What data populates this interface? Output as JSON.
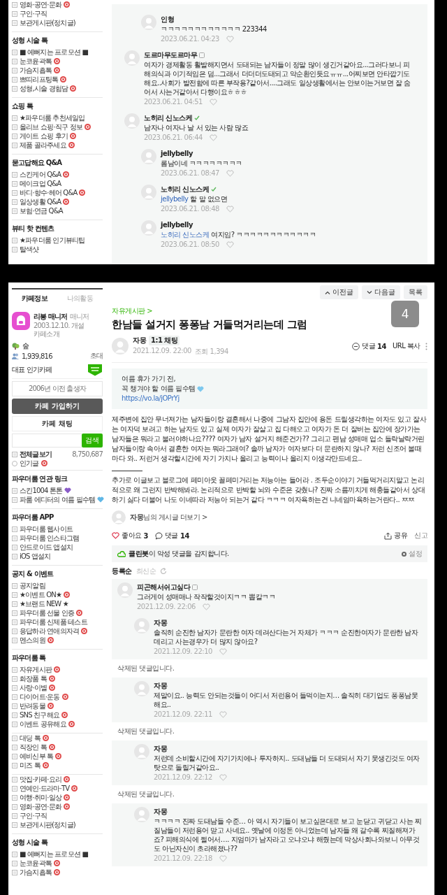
{
  "top_panel": {
    "sidebar": {
      "sections": [
        {
          "items": [
            {
              "label": "영화·공연·문화",
              "new": true
            },
            {
              "label": "구인·구직",
              "new": false
            },
            {
              "label": "보관게시판(정치글)",
              "new": false
            }
          ]
        },
        {
          "title": "성형 시술 톡",
          "items": [
            {
              "label": "■ 예뻐지는 프로모션 ■",
              "new": false
            },
            {
              "label": "눈코윤곽톡",
              "new": true
            },
            {
              "label": "가슴지흡톡",
              "new": true
            },
            {
              "label": "쁘띠리프팅톡",
              "new": true
            },
            {
              "label": "성형,시술 경험담",
              "new": true
            }
          ]
        },
        {
          "title": "쇼핑 톡",
          "items": [
            {
              "label": "★파우더룸 추천세일입",
              "new": false
            },
            {
              "label": "올리브 쇼핑·직구 정보",
              "new": true
            },
            {
              "label": "게이트 쇼핑 후기",
              "new": true
            },
            {
              "label": "제품 골라주세요",
              "new": true
            }
          ]
        },
        {
          "title": "묻고답해요 Q&A",
          "items": [
            {
              "label": "스킨케어 Q&A",
              "new": true
            },
            {
              "label": "메이크업 Q&A",
              "new": false
            },
            {
              "label": "바디·향수·헤어 Q&A",
              "new": true
            },
            {
              "label": "일상생활 Q&A",
              "new": true
            },
            {
              "label": "보험·연금 Q&A",
              "new": false
            }
          ]
        },
        {
          "title": "뷰티 핫 컨텐츠",
          "items": [
            {
              "label": "★파우더룸 인기뷰티팁",
              "new": false
            },
            {
              "label": "탈색샷",
              "new": false
            }
          ]
        }
      ]
    },
    "comments": [
      {
        "kind": "comment",
        "reply": true,
        "author": "인형",
        "text": "ㅋㅋㅋㅋㅋㅋㅋㅋㅋㅋㅋㅋ 223344",
        "date": "2023.06.21. 04:23"
      },
      {
        "kind": "comment",
        "reply": false,
        "author": "도르마무도르마무",
        "grade_icon": true,
        "text": "여자가 경제활동 활발해지면서 도태되는 남자들이 정말 많이 생긴거같아요...그러다보니 피해의식과 이기적임은 덤...그래서 더더더도태되고 악순환인듯요ㅠㅠ...어찌보면 안타깝기도해요..사회가 발전함에 따른 부작용?같아서....그래도 일상생활에서는 안보이는거보면 잘 숨어서 사는거같아서 다행이요ㅎㅎㅎ",
        "date": "2023.06.21. 04:51"
      },
      {
        "kind": "comment",
        "reply": false,
        "author": "노히리 신노스케",
        "verified": true,
        "text": "남자나 여자나 날 서 있는 사람 많죠",
        "date": "2023.06.21. 06:44"
      },
      {
        "kind": "comment",
        "reply": true,
        "author": "jellybelly",
        "text": "롬남이네 ㅋㅋㅋㅋㅋㅋㅋㅋ",
        "date": "2023.06.21. 08:47"
      },
      {
        "kind": "comment",
        "reply": true,
        "author": "노히리 신노스케",
        "verified": true,
        "mention": "jellybelly",
        "text": "할 말 없으면",
        "date": "2023.06.21. 08:48"
      },
      {
        "kind": "comment",
        "reply": true,
        "author": "jellybelly",
        "mention": "노히리 신노스케",
        "text": "여지임? ㅋㅋㅋㅋㅋㅋㅋㅋㅋㅋㅋㅋ",
        "date": "2023.06.21. 08:50"
      }
    ]
  },
  "bottom_panel": {
    "sidebar": {
      "tabs": [
        {
          "label": "카페정보",
          "selected": true
        },
        {
          "label": "나의활동",
          "selected": false
        }
      ],
      "cafe": {
        "manager": "리봉 매니저",
        "role": "매니저",
        "founded": "2003.12.10. 개설",
        "intro_link": "카페소개",
        "grade": "숲",
        "members": "1,939,816",
        "invite": "초대",
        "popular_label": "대표 인기카페",
        "restriction": "2006년 이전 출생자",
        "join_button": "카페 가입하기",
        "chat_button": "카페 채팅",
        "search_button": "검색",
        "all_posts": "전체글보기",
        "all_posts_count": "8,750,687",
        "popular_posts": "인기글",
        "popular_posts_new": true
      },
      "sections": [
        {
          "title": "파우더룸 연관 링크",
          "items": [
            {
              "label": "스킨1004 톤톤",
              "new": false,
              "color": "#8a5cc8"
            },
            {
              "label": "파룸 에디터의 여름 필수템",
              "new": false,
              "color": "#5fb7e6"
            }
          ]
        },
        {
          "title": "파우더룸 APP",
          "items": [
            {
              "label": "파우더룸 웹사이트",
              "new": false
            },
            {
              "label": "파우더룸 인스타그램",
              "new": false
            },
            {
              "label": "안드로이드 앱설치",
              "new": false
            },
            {
              "label": "iOS 앱설치",
              "new": false
            }
          ]
        },
        {
          "title": "공지 & 이벤트",
          "items": [
            {
              "label": "공지알림",
              "new": false
            },
            {
              "label": "★이벤트 ON★",
              "new": true
            },
            {
              "label": "★브랜드 NEW ★",
              "new": false
            },
            {
              "label": "파우더룸 선물 인증",
              "new": true
            },
            {
              "label": "파우더룸 신제품 테스트",
              "new": false
            },
            {
              "label": "응답하라 연애의자격",
              "new": true
            },
            {
              "label": "멘스의원",
              "new": true
            }
          ]
        },
        {
          "title": "파우더룸 톡",
          "items": [
            {
              "label": "자유게시판",
              "new": true
            },
            {
              "label": "화장품 톡",
              "new": true
            },
            {
              "label": "사랑·이별",
              "new": true
            },
            {
              "label": "다이어트·운동",
              "new": true
            },
            {
              "label": "반려동물",
              "new": true
            },
            {
              "label": "SNS 친구해요",
              "new": true
            },
            {
              "label": "이벤트 공유해요",
              "new": true
            }
          ]
        },
        {
          "items": [
            {
              "label": "대딩 톡",
              "new": true
            },
            {
              "label": "직장인 톡",
              "new": true
            },
            {
              "label": "예비신부 톡",
              "new": true
            },
            {
              "label": "미즈 톡",
              "new": true
            }
          ]
        },
        {
          "items": [
            {
              "label": "맛집·카페·요리",
              "new": true
            },
            {
              "label": "연예인·드라마·TV",
              "new": true
            },
            {
              "label": "여행·취미·일상",
              "new": true
            },
            {
              "label": "영화·공연·문화",
              "new": true
            },
            {
              "label": "구인·구직",
              "new": false
            },
            {
              "label": "보관게시판(정치글)",
              "new": false
            }
          ]
        },
        {
          "title": "성형 시술 톡",
          "items": [
            {
              "label": "■ 예뻐지는 프로모션 ■",
              "new": false
            },
            {
              "label": "눈코윤곽톡",
              "new": true
            },
            {
              "label": "가슴지흡톡",
              "new": true
            }
          ]
        }
      ]
    },
    "nav_buttons": [
      {
        "label": "이전글",
        "kind": "prev"
      },
      {
        "label": "다음글",
        "kind": "next"
      },
      {
        "label": "목록",
        "kind": "list"
      }
    ],
    "page_indicator": "4",
    "post": {
      "board": "자유게시판 >",
      "title": "한남들 설거지 퐁퐁남 거들먹거리는데 그럼",
      "author": "자몽",
      "chat_chip": "1:1 채팅",
      "date": "2021.12.09. 22:00",
      "views": "조회 1,394",
      "comment_label": "댓글",
      "comment_count": "14",
      "url_copy": "URL 복사",
      "ad": {
        "lines": [
          "여름 휴가 가기 전,",
          "꼭 챙겨야 할 여름 필수템"
        ],
        "link": "https://vo.la/jOPrYj"
      },
      "paragraphs": [
        "제주변에 집안 무너져가는 남자들이랑 결혼해서 나중에 그남자 집안에 용돈 드릴생각하는 여자도 있고 잘사는 여자덕 보려고 하는 남자도 있고 실제 여자가 잘살고 집 다해오고 여자가 돈 더 잘버는 집안에 장가가는 남자들은 뭐라고 불러야하나요???? 여자가 남자 설거지 해준건가?? 그리고 펜남 성매매 업소 들락날락거린 남자들이랑 속아서 결혼한 여자는 뭐라그래여? 솔까 남자가 여자보다 더 문란하지 않나? 저런 신조어 볼때마다 와.. 저런거 생각할시간에 자기 가치나 올리고 능력이나 올리지 이생각만드네요..",
        "추가로 이글보고 블로그에 페미아웃 꼴페미거리는 저능아는 들어라 . 조두순이야기 거들먹거리지말고 논리적으로 왜 그런지 반박해봐라. 논리적으로 반박할 뇌와 수준은 갖췄나? 진짜 소름끼치게 해충들같아서 상대하기 싫다 더불어 나도 이네따라 저능아 되는거 같다 ㅋㅋㅋ 여자욕하는건 니네엄마욕하는거란다.. ㅉㅉ"
      ],
      "more_posts": "**자몽**님의 게시글 더보기 >",
      "like_label": "좋아요",
      "like_count": "3",
      "action_comment_label": "댓글",
      "action_comment_count": "14",
      "share": "공유",
      "report": "신고",
      "cleanbot": "**클린봇**이 악성 댓글을 감지합니다.",
      "cleanbot_setting": "설정"
    },
    "sort_tabs": [
      {
        "label": "등록순",
        "selected": true
      },
      {
        "label": "최신순",
        "selected": false
      }
    ],
    "comments": [
      {
        "kind": "comment",
        "reply": false,
        "author": "피곤해서쉬고싶다",
        "grade_icon": true,
        "text": "그러게여 성매매나 작작할것이지ㅋㅋ 뽑칼ㅋㅋ",
        "date": "2021.12.09. 22:06"
      },
      {
        "kind": "comment",
        "reply": true,
        "author": "자몽",
        "text": "솔직히 순진한 남자가 문란한 여자 데려산다는거 자체가 ㅋㅋㅋ 순진한여자가 문란한 남자 데리고 사는경우가 더 많지 않아요?",
        "date": "2021.12.09. 22:10"
      },
      {
        "kind": "deleted",
        "text": "삭제된 댓글입니다."
      },
      {
        "kind": "comment",
        "reply": true,
        "author": "자몽",
        "text": "제말이요.. 능력도 안되는것들이 어디서 저런용어 들먹이는지… 솔직히 대기업도 퐁퐁남못해요..",
        "date": "2021.12.09. 22:11"
      },
      {
        "kind": "deleted",
        "text": "삭제된 댓글입니다."
      },
      {
        "kind": "comment",
        "reply": true,
        "author": "자몽",
        "text": "저런데 소비할시간에 자기가치에나 투자하지.. 도태남들 더 도태되서 자기 못생긴것도 여자탓으로 돌릴거같아요..",
        "date": "2021.12.09. 22:12"
      },
      {
        "kind": "deleted",
        "text": "삭제된 댓글입니다."
      },
      {
        "kind": "comment",
        "reply": true,
        "author": "자몽",
        "text": "ㅋㅋㅋㅋ 진짜 도태남들 수준… 아 역시 자기들이 보고싶은대로 보고 눈닫고 귀닫고 사는 찌질남들이 저런용어 맏고 사네요.. 옛날에 이정돈 아니었는데 남자들 왜 갈수록 찌질해져가죠? 피해의식에 쩔어서…. 지엄마가 남자라고 오냐오냐 해줬는데 막상사회나와보니 아무것도 아닌자신이 초라해졌나??",
        "date": "2021.12.09. 22:18"
      }
    ]
  }
}
